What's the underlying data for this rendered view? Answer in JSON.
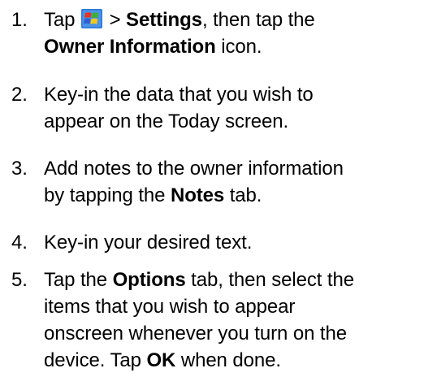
{
  "steps": [
    {
      "number": "1.",
      "parts": [
        "Tap",
        "> ",
        "Settings",
        ", then tap the",
        "Owner Information",
        " icon."
      ]
    },
    {
      "number": "2.",
      "lines": [
        "Key-in the data that you wish to",
        "appear on the Today screen."
      ]
    },
    {
      "number": "3.",
      "parts": [
        "Add notes to the owner information",
        "by tapping the ",
        "Notes",
        " tab."
      ]
    },
    {
      "number": "4.",
      "text": "Key-in your desired text."
    },
    {
      "number": "5.",
      "parts": [
        "Tap the ",
        "Options",
        " tab, then select the",
        "items that you wish to appear",
        "onscreen whenever you turn on the",
        "device. Tap ",
        "OK",
        " when done."
      ]
    }
  ],
  "icons": {
    "start": "windows-start-flag-icon"
  },
  "colors": {
    "flag_red": "#e8331f",
    "flag_green": "#3fae3a",
    "flag_blue": "#2f5fd0",
    "flag_yellow": "#f5c71a",
    "icon_bg": "#2a78d8"
  }
}
